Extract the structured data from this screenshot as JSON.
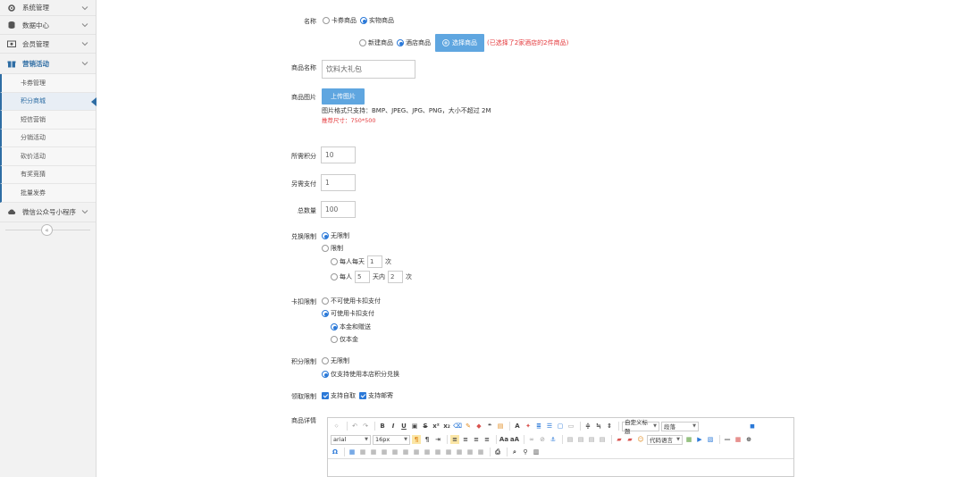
{
  "sidebar": {
    "groups": [
      {
        "label": "系统管理",
        "icon": "gear-icon"
      },
      {
        "label": "数据中心",
        "icon": "database-icon"
      },
      {
        "label": "会员管理",
        "icon": "member-card-icon"
      },
      {
        "label": "营销活动",
        "icon": "gift-icon"
      }
    ],
    "subitems": [
      "卡券管理",
      "积分商城",
      "短信营销",
      "分销活动",
      "砍价活动",
      "有奖竞猜",
      "批量发券"
    ],
    "last_group": {
      "label": "微信公众号小程序",
      "icon": "cloud-icon"
    },
    "collapse_glyph": "«"
  },
  "form": {
    "name_label": "名称",
    "type_options": [
      "卡券商品",
      "实物商品"
    ],
    "source_options": [
      "新建商品",
      "酒店商品"
    ],
    "select_button": "选择商品",
    "select_note": "(已选择了2家酒店的2件商品)",
    "product_name_label": "商品名称",
    "product_name_value": "饮料大礼包",
    "image_label": "商品图片",
    "upload_button": "上传图片",
    "image_format_note": "图片格式只支持：BMP、JPEG、JPG、PNG，大小不超过 2M",
    "image_size_note": "推荐尺寸：750*500",
    "points_label": "所需积分",
    "points_value": "10",
    "extra_pay_label": "另需支付",
    "extra_pay_value": "1",
    "total_label": "总数量",
    "total_value": "100",
    "exchange_label": "兑换限制",
    "exchange_unlimited": "无限制",
    "exchange_limited": "限制",
    "per_day_prefix": "每人每天",
    "per_day_value": "1",
    "times": "次",
    "per_person_prefix": "每人",
    "per_person_days": "5",
    "within_days": "天内",
    "per_person_times": "2",
    "card_label": "卡扣限制",
    "card_no": "不可使用卡扣支付",
    "card_yes": "可使用卡扣支付",
    "card_opt1": "本金和赠送",
    "card_opt2": "仅本金",
    "points_limit_label": "积分限制",
    "points_limit_none": "无限制",
    "points_limit_store": "仅支持使用本店积分兑换",
    "pickup_label": "领取限制",
    "pickup_self": "支持自取",
    "pickup_delivery": "支持邮寄",
    "detail_label": "商品详情"
  },
  "editor": {
    "font_family": "arial",
    "font_size": "16px",
    "heading": "自定义标题",
    "paragraph": "段落",
    "code_lang": "代码语言"
  },
  "colors": {
    "accent": "#2b79d8",
    "button": "#5fa6e0",
    "warn": "#e4393c"
  }
}
